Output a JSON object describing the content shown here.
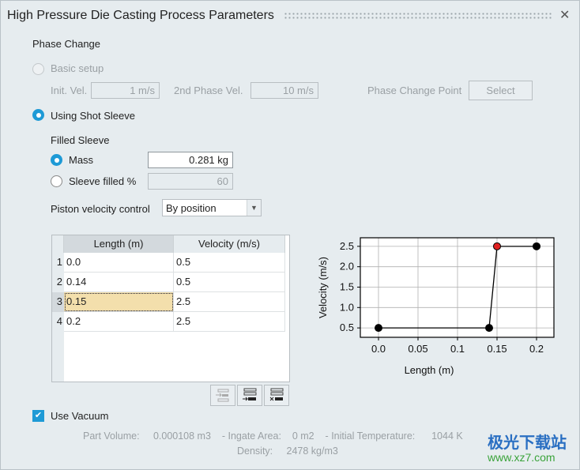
{
  "window": {
    "title": "High Pressure Die Casting Process Parameters",
    "close_label": "✕"
  },
  "phase_change": {
    "heading": "Phase Change",
    "basic_setup": {
      "label": "Basic setup",
      "selected": false,
      "enabled": false,
      "init_vel_label": "Init. Vel.",
      "init_vel_value": "1 m/s",
      "second_vel_label": "2nd Phase Vel.",
      "second_vel_value": "10 m/s",
      "change_point_label": "Phase Change Point",
      "select_label": "Select"
    },
    "shot_sleeve": {
      "label": "Using Shot Sleeve",
      "selected": true
    }
  },
  "filled_sleeve": {
    "heading": "Filled Sleeve",
    "mass": {
      "label": "Mass",
      "value": "0.281 kg",
      "selected": true
    },
    "percent": {
      "label": "Sleeve filled %",
      "value": "60",
      "selected": false
    }
  },
  "piston": {
    "label": "Piston velocity control",
    "value": "By position"
  },
  "table": {
    "columns": [
      "Length (m)",
      "Velocity (m/s)"
    ],
    "rows": [
      {
        "n": "1",
        "length": "0.0",
        "velocity": "0.5"
      },
      {
        "n": "2",
        "length": "0.14",
        "velocity": "0.5"
      },
      {
        "n": "3",
        "length": "0.15",
        "velocity": "2.5"
      },
      {
        "n": "4",
        "length": "0.2",
        "velocity": "2.5"
      }
    ],
    "selected_row": 2,
    "toolbar": [
      "insert-row-icon",
      "append-row-icon",
      "delete-row-icon"
    ]
  },
  "chart_data": {
    "type": "line",
    "xlabel": "Length (m)",
    "ylabel": "Velocity (m/s)",
    "x": [
      0.0,
      0.14,
      0.15,
      0.2
    ],
    "y": [
      0.5,
      0.5,
      2.5,
      2.5
    ],
    "xlim": [
      -0.023,
      0.222
    ],
    "ylim": [
      0.27,
      2.71
    ],
    "xticks": [
      "0.0",
      "0.05",
      "0.1",
      "0.15",
      "0.2"
    ],
    "xtick_values": [
      0,
      0.05,
      0.1,
      0.15,
      0.2
    ],
    "yticks": [
      "0.5",
      "1.0",
      "1.5",
      "2.0",
      "2.5"
    ],
    "ytick_values": [
      0.5,
      1.0,
      1.5,
      2.0,
      2.5
    ],
    "highlight_index": 2,
    "highlight_color": "#e02020",
    "point_color": "#000000",
    "grid": true
  },
  "vacuum": {
    "label": "Use Vacuum",
    "checked": true
  },
  "info": {
    "part_volume_label": "Part Volume:",
    "part_volume": "0.000108 m3",
    "sep": "-",
    "ingate_label": "Ingate Area:",
    "ingate": "0 m2",
    "temp_label": "Initial Temperature:",
    "temp": "1044 K",
    "density_label": "Density:",
    "density": "2478 kg/m3"
  },
  "watermark": {
    "text": "极光下载站",
    "url": "www.xz7.com"
  },
  "colors": {
    "accent": "#1e9ad6",
    "background": "#e6ecef",
    "selection": "#f3dfac"
  }
}
